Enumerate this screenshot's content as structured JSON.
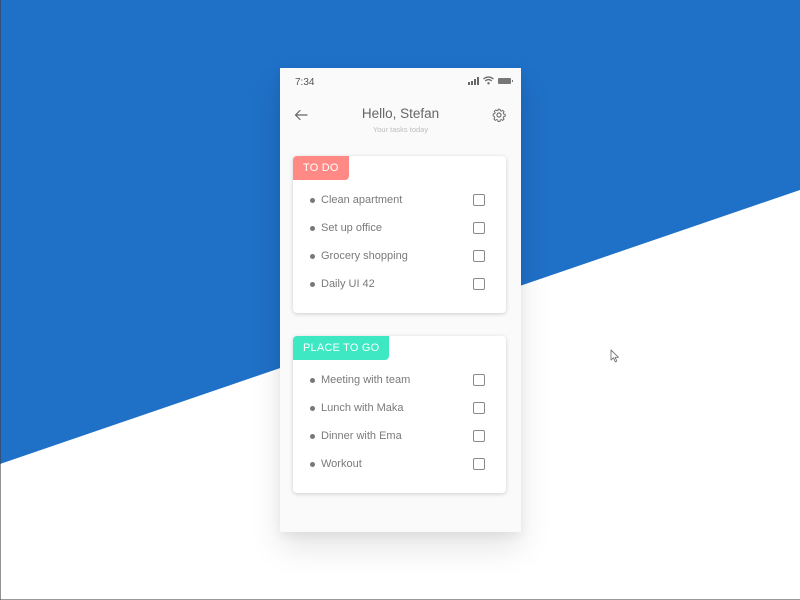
{
  "colors": {
    "background_accent": "#1f70c7",
    "background_base": "#ffffff",
    "todo_tag": "#ff8a85",
    "place_tag": "#3de8c2"
  },
  "status_bar": {
    "time": "7:34",
    "icons": [
      "signal-icon",
      "wifi-icon",
      "battery-icon"
    ]
  },
  "header": {
    "back_icon": "arrow-left-icon",
    "title": "Hello, Stefan",
    "subtitle": "Your tasks today",
    "settings_icon": "gear-icon"
  },
  "lists": [
    {
      "tag": "TO DO",
      "items": [
        {
          "label": "Clean apartment",
          "checked": false
        },
        {
          "label": "Set up office",
          "checked": false
        },
        {
          "label": "Grocery shopping",
          "checked": false
        },
        {
          "label": "Daily UI 42",
          "checked": false
        }
      ]
    },
    {
      "tag": "PLACE TO GO",
      "items": [
        {
          "label": "Meeting with team",
          "checked": false
        },
        {
          "label": "Lunch with Maka",
          "checked": false
        },
        {
          "label": "Dinner with Ema",
          "checked": false
        },
        {
          "label": "Workout",
          "checked": false
        }
      ]
    }
  ],
  "cursor_icon": "mouse-pointer-icon"
}
